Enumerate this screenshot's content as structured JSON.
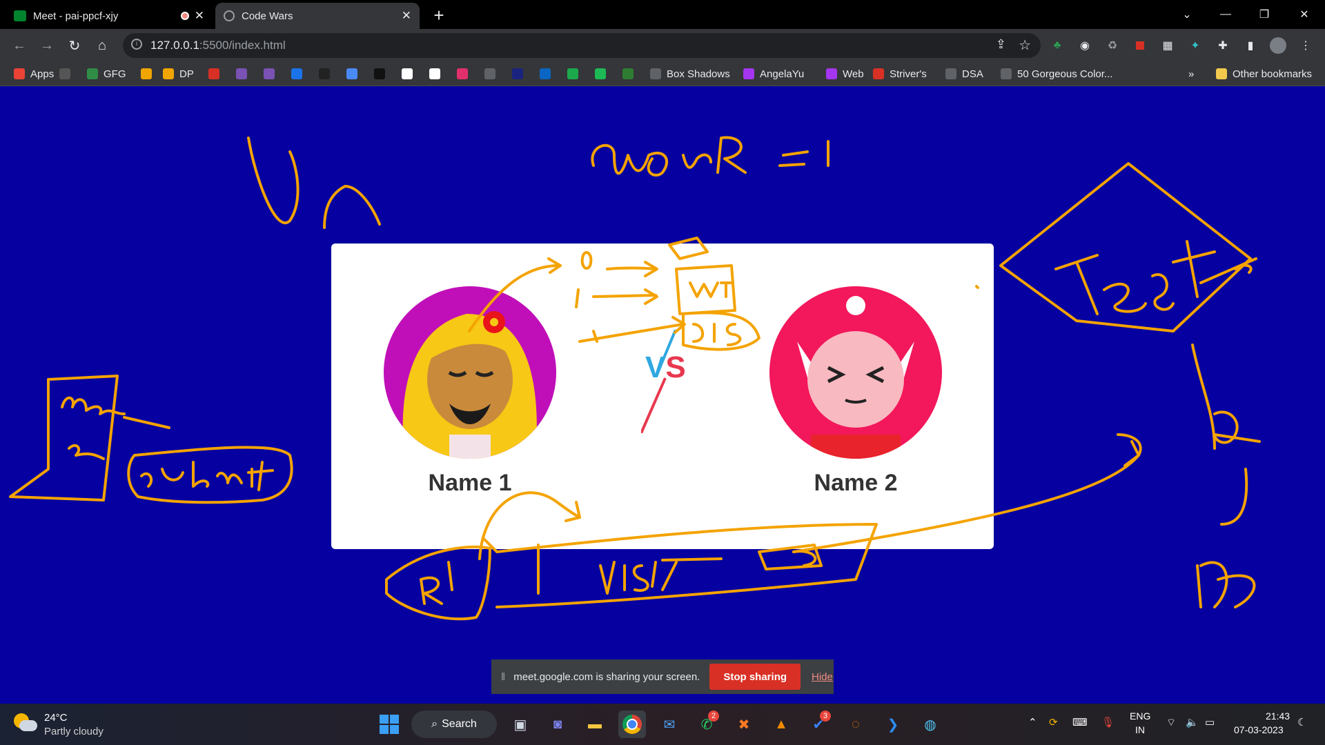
{
  "browser": {
    "tabs": [
      {
        "title": "Meet - pai-ppcf-xjy",
        "active": false,
        "recording": true
      },
      {
        "title": "Code Wars",
        "active": true
      }
    ],
    "new_tab_glyph": "+",
    "url_host": "127.0.0.1",
    "url_path": ":5500/index.html",
    "window_buttons": [
      "chevron-down",
      "minimize",
      "restore",
      "close"
    ],
    "bookmarks": [
      {
        "label": "Apps",
        "icon": "apps-grid"
      },
      {
        "label": "",
        "icon": "cc"
      },
      {
        "label": "GFG",
        "icon": "gfg"
      },
      {
        "label": "",
        "icon": "layers"
      },
      {
        "label": "DP",
        "icon": "layers"
      },
      {
        "label": "",
        "icon": "gmail"
      },
      {
        "label": "",
        "icon": "bootstrap"
      },
      {
        "label": "",
        "icon": "bootstrap"
      },
      {
        "label": "",
        "icon": "c"
      },
      {
        "label": "",
        "icon": "codepen"
      },
      {
        "label": "",
        "icon": "flag"
      },
      {
        "label": "",
        "icon": "github"
      },
      {
        "label": "",
        "icon": "gfr"
      },
      {
        "label": "",
        "icon": "chart"
      },
      {
        "label": "",
        "icon": "instagram"
      },
      {
        "label": "",
        "icon": "rocket"
      },
      {
        "label": "",
        "icon": "p"
      },
      {
        "label": "",
        "icon": "linkedin"
      },
      {
        "label": "",
        "icon": "leetcode"
      },
      {
        "label": "",
        "icon": "spotify"
      },
      {
        "label": "",
        "icon": "arrow"
      },
      {
        "label": "Box Shadows",
        "icon": "cursor"
      },
      {
        "label": "AngelaYu",
        "icon": "udemy"
      },
      {
        "label": "Web",
        "icon": "udemy"
      },
      {
        "label": "Striver's",
        "icon": "tuf"
      },
      {
        "label": "DSA",
        "icon": "t"
      },
      {
        "label": "50 Gorgeous Color...",
        "icon": "palette"
      }
    ],
    "bookmarks_more": "»",
    "other_bookmarks": "Other bookmarks"
  },
  "page": {
    "player1": "Name 1",
    "player2": "Name 2",
    "vs_text": "VS",
    "vs_colors": {
      "v": "#2fa8e0",
      "s": "#e8384f"
    },
    "background": "#0600a0"
  },
  "sharing": {
    "message": "meet.google.com is sharing your screen.",
    "stop_label": "Stop sharing",
    "hide_label": "Hide"
  },
  "taskbar": {
    "weather_temp": "24°C",
    "weather_desc": "Partly cloudy",
    "search_label": "Search",
    "badges": {
      "whatsapp": "2",
      "todo": "3"
    },
    "lang_top": "ENG",
    "lang_bottom": "IN",
    "time": "21:43",
    "date": "07-03-2023"
  },
  "annotation_color": "#f4a300"
}
